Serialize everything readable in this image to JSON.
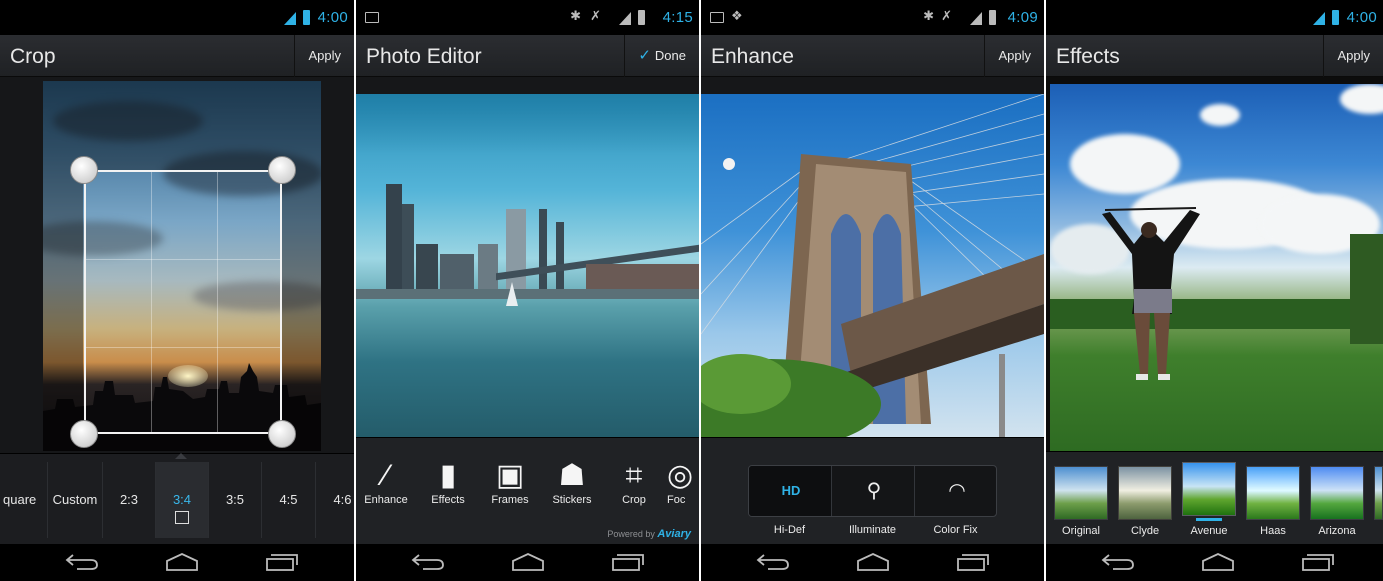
{
  "screens": {
    "crop": {
      "status_time": "4:00",
      "title": "Crop",
      "apply_label": "Apply",
      "ratios": [
        "quare",
        "Custom",
        "2:3",
        "3:4",
        "3:5",
        "4:5",
        "4:6"
      ],
      "selected_ratio": "3:4"
    },
    "photo_editor": {
      "status_time": "4:15",
      "title": "Photo Editor",
      "done_label": "Done",
      "tools": [
        "Enhance",
        "Effects",
        "Frames",
        "Stickers",
        "Crop",
        "Foc"
      ],
      "powered_by": "Powered by",
      "brand": "Aviary"
    },
    "enhance": {
      "status_time": "4:09",
      "title": "Enhance",
      "apply_label": "Apply",
      "options": [
        "Hi-Def",
        "Illuminate",
        "Color Fix"
      ],
      "selected_option": "Hi-Def"
    },
    "effects": {
      "status_time": "4:00",
      "title": "Effects",
      "apply_label": "Apply",
      "effects": [
        "Original",
        "Clyde",
        "Avenue",
        "Haas",
        "Arizona"
      ],
      "selected_effect": "Avenue"
    }
  },
  "icons": {
    "back": "back-arrow-icon",
    "home": "home-icon",
    "recents": "recent-apps-icon"
  },
  "colors": {
    "accent": "#2fb2e6",
    "actionbar": "#2b2d31",
    "panel": "#202225",
    "navbar": "#000000"
  }
}
